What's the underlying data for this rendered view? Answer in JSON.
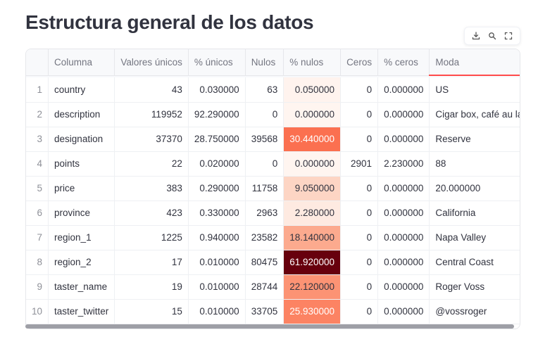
{
  "title": "Estructura general de los datos",
  "toolbar": {
    "icons": [
      "download-icon",
      "search-icon",
      "fullscreen-icon"
    ]
  },
  "table": {
    "columns": [
      "",
      "Columna",
      "Valores únicos",
      "% únicos",
      "Nulos",
      "% nulos",
      "Ceros",
      "% ceros",
      "Moda"
    ],
    "rows": [
      {
        "idx": "1",
        "col": "country",
        "unique": "43",
        "pct_unique": "0.030000",
        "nulls": "63",
        "pct_nulls": "0.050000",
        "zeros": "0",
        "pct_zeros": "0.000000",
        "mode": "US",
        "heat": "#fff3ee",
        "heat_text": "#31333f"
      },
      {
        "idx": "2",
        "col": "description",
        "unique": "119952",
        "pct_unique": "92.290000",
        "nulls": "0",
        "pct_nulls": "0.000000",
        "zeros": "0",
        "pct_zeros": "0.000000",
        "mode": "Cigar box, café au lait, and dried tobacco aromas",
        "heat": "#fff5f0",
        "heat_text": "#31333f"
      },
      {
        "idx": "3",
        "col": "designation",
        "unique": "37370",
        "pct_unique": "28.750000",
        "nulls": "39568",
        "pct_nulls": "30.440000",
        "zeros": "0",
        "pct_zeros": "0.000000",
        "mode": "Reserve",
        "heat": "#fb7050",
        "heat_text": "#ffffff"
      },
      {
        "idx": "4",
        "col": "points",
        "unique": "22",
        "pct_unique": "0.020000",
        "nulls": "0",
        "pct_nulls": "0.000000",
        "zeros": "2901",
        "pct_zeros": "2.230000",
        "mode": "88",
        "heat": "#fff5f0",
        "heat_text": "#31333f"
      },
      {
        "idx": "5",
        "col": "price",
        "unique": "383",
        "pct_unique": "0.290000",
        "nulls": "11758",
        "pct_nulls": "9.050000",
        "zeros": "0",
        "pct_zeros": "0.000000",
        "mode": "20.000000",
        "heat": "#fdd5c4",
        "heat_text": "#31333f"
      },
      {
        "idx": "6",
        "col": "province",
        "unique": "423",
        "pct_unique": "0.330000",
        "nulls": "2963",
        "pct_nulls": "2.280000",
        "zeros": "0",
        "pct_zeros": "0.000000",
        "mode": "California",
        "heat": "#feeae1",
        "heat_text": "#31333f"
      },
      {
        "idx": "7",
        "col": "region_1",
        "unique": "1225",
        "pct_unique": "0.940000",
        "nulls": "23582",
        "pct_nulls": "18.140000",
        "zeros": "0",
        "pct_zeros": "0.000000",
        "mode": "Napa Valley",
        "heat": "#fcaa8e",
        "heat_text": "#31333f"
      },
      {
        "idx": "8",
        "col": "region_2",
        "unique": "17",
        "pct_unique": "0.010000",
        "nulls": "80475",
        "pct_nulls": "61.920000",
        "zeros": "0",
        "pct_zeros": "0.000000",
        "mode": "Central Coast",
        "heat": "#67000d",
        "heat_text": "#ffffff"
      },
      {
        "idx": "9",
        "col": "taster_name",
        "unique": "19",
        "pct_unique": "0.010000",
        "nulls": "28744",
        "pct_nulls": "22.120000",
        "zeros": "0",
        "pct_zeros": "0.000000",
        "mode": "Roger Voss",
        "heat": "#fc9374",
        "heat_text": "#31333f"
      },
      {
        "idx": "10",
        "col": "taster_twitter",
        "unique": "15",
        "pct_unique": "0.010000",
        "nulls": "33705",
        "pct_nulls": "25.930000",
        "zeros": "0",
        "pct_zeros": "0.000000",
        "mode": "@vossroger",
        "heat": "#fc8363",
        "heat_text": "#ffffff"
      }
    ]
  }
}
